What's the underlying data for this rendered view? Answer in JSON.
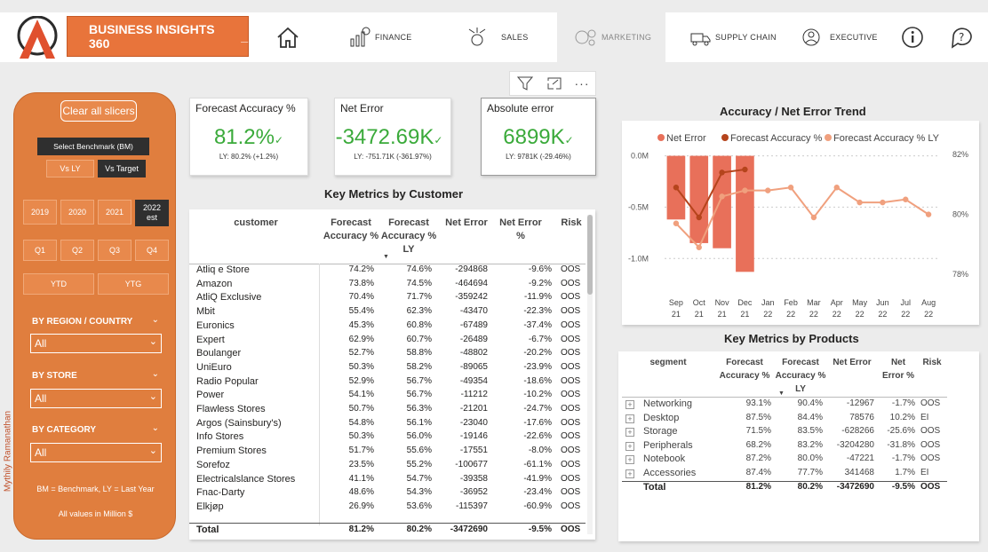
{
  "brand": "BUSINESS INSIGHTS 360",
  "brand_suffix": "_",
  "nav": [
    {
      "label": "FINANCE"
    },
    {
      "label": "SALES"
    },
    {
      "label": "MARKETING"
    },
    {
      "label": "SUPPLY CHAIN"
    },
    {
      "label": "EXECUTIVE"
    }
  ],
  "toolbar": {
    "more": "···"
  },
  "slicer": {
    "clear": "Clear all slicers",
    "benchmark_label": "Select Benchmark (BM)",
    "vs_ly": "Vs LY",
    "vs_target": "Vs Target",
    "years": [
      "2019",
      "2020",
      "2021",
      "2022 est"
    ],
    "quarters": [
      "Q1",
      "Q2",
      "Q3",
      "Q4"
    ],
    "ytd": "YTD",
    "ytg": "YTG",
    "region_label": "BY REGION / COUNTRY",
    "region_value": "All",
    "store_label": "BY STORE",
    "store_value": "All",
    "category_label": "BY CATEGORY",
    "category_value": "All",
    "note1": "BM = Benchmark, LY = Last Year",
    "note2": "All values in Million $",
    "author": "Mythily Ramanathan"
  },
  "kpis": {
    "fa": {
      "title": "Forecast Accuracy %",
      "value": "81.2%",
      "sub": "LY: 80.2% (+1.2%)"
    },
    "ne": {
      "title": "Net Error",
      "value": "-3472.69K",
      "sub": "LY: -751.71K (-361.97%)"
    },
    "ae": {
      "title": "Absolute error",
      "value": "6899K",
      "sub": "LY: 9781K (-29.46%)"
    }
  },
  "colors": {
    "accent": "#e07e3e",
    "good": "#3aaa3a",
    "bar": "#e8705a",
    "line_dark": "#b5441c",
    "line_light": "#f0a07e"
  },
  "customer_table": {
    "title": "Key Metrics by Customer",
    "headers": [
      "customer",
      "Forecast Accuracy %",
      "Forecast Accuracy % LY",
      "Net Error",
      "Net Error %",
      "Risk"
    ],
    "rows": [
      [
        "Atliq e Store",
        "74.2%",
        "74.6%",
        "-294868",
        "-9.6%",
        "OOS"
      ],
      [
        "Amazon",
        "73.8%",
        "74.5%",
        "-464694",
        "-9.2%",
        "OOS"
      ],
      [
        "AtliQ Exclusive",
        "70.4%",
        "71.7%",
        "-359242",
        "-11.9%",
        "OOS"
      ],
      [
        "Mbit",
        "55.4%",
        "62.3%",
        "-43470",
        "-22.3%",
        "OOS"
      ],
      [
        "Euronics",
        "45.3%",
        "60.8%",
        "-67489",
        "-37.4%",
        "OOS"
      ],
      [
        "Expert",
        "62.9%",
        "60.7%",
        "-26489",
        "-6.7%",
        "OOS"
      ],
      [
        "Boulanger",
        "52.7%",
        "58.8%",
        "-48802",
        "-20.2%",
        "OOS"
      ],
      [
        "UniEuro",
        "50.3%",
        "58.2%",
        "-89065",
        "-23.9%",
        "OOS"
      ],
      [
        "Radio Popular",
        "52.9%",
        "56.7%",
        "-49354",
        "-18.6%",
        "OOS"
      ],
      [
        "Power",
        "54.1%",
        "56.7%",
        "-11212",
        "-10.2%",
        "OOS"
      ],
      [
        "Flawless Stores",
        "50.7%",
        "56.3%",
        "-21201",
        "-24.7%",
        "OOS"
      ],
      [
        "Argos (Sainsbury's)",
        "54.8%",
        "56.1%",
        "-23040",
        "-17.6%",
        "OOS"
      ],
      [
        "Info Stores",
        "50.3%",
        "56.0%",
        "-19146",
        "-22.6%",
        "OOS"
      ],
      [
        "Premium Stores",
        "51.7%",
        "55.6%",
        "-17551",
        "-8.0%",
        "OOS"
      ],
      [
        "Sorefoz",
        "23.5%",
        "55.2%",
        "-100677",
        "-61.1%",
        "OOS"
      ],
      [
        "Electricalslance Stores",
        "41.1%",
        "54.7%",
        "-39358",
        "-41.9%",
        "OOS"
      ],
      [
        "Fnac-Darty",
        "48.6%",
        "54.3%",
        "-36952",
        "-23.4%",
        "OOS"
      ],
      [
        "Elkjøp",
        "26.9%",
        "53.6%",
        "-115397",
        "-60.9%",
        "OOS"
      ]
    ],
    "total": [
      "Total",
      "81.2%",
      "80.2%",
      "-3472690",
      "-9.5%",
      "OOS"
    ]
  },
  "product_table": {
    "title": "Key Metrics by Products",
    "headers": [
      "segment",
      "Forecast Accuracy %",
      "Forecast Accuracy % LY",
      "Net Error",
      "Net Error %",
      "Risk"
    ],
    "rows": [
      [
        "Networking",
        "93.1%",
        "90.4%",
        "-12967",
        "-1.7%",
        "OOS"
      ],
      [
        "Desktop",
        "87.5%",
        "84.4%",
        "78576",
        "10.2%",
        "EI"
      ],
      [
        "Storage",
        "71.5%",
        "83.5%",
        "-628266",
        "-25.6%",
        "OOS"
      ],
      [
        "Peripherals",
        "68.2%",
        "83.2%",
        "-3204280",
        "-31.8%",
        "OOS"
      ],
      [
        "Notebook",
        "87.2%",
        "80.0%",
        "-47221",
        "-1.7%",
        "OOS"
      ],
      [
        "Accessories",
        "87.4%",
        "77.7%",
        "341468",
        "1.7%",
        "EI"
      ]
    ],
    "total": [
      "Total",
      "81.2%",
      "80.2%",
      "-3472690",
      "-9.5%",
      "OOS"
    ]
  },
  "chart_data": {
    "type": "bar",
    "title": "Accuracy / Net Error Trend",
    "legend": [
      "Net Error",
      "Forecast Accuracy %",
      "Forecast Accuracy % LY"
    ],
    "legend_position": "top",
    "categories": [
      "Sep 21",
      "Oct 21",
      "Nov 21",
      "Dec 21",
      "Jan 22",
      "Feb 22",
      "Mar 22",
      "Apr 22",
      "May 22",
      "Jun 22",
      "Jul 22",
      "Aug 22"
    ],
    "left_axis": {
      "ticks": [
        "0.0M",
        "-0.5M",
        "-1.0M"
      ],
      "range": [
        -1.3,
        0.1
      ]
    },
    "right_axis": {
      "ticks": [
        "82%",
        "80%",
        "78%"
      ],
      "range": [
        77.5,
        82.3
      ]
    },
    "series": [
      {
        "name": "Net Error",
        "kind": "bar",
        "values": [
          -0.62,
          -0.85,
          -0.9,
          -1.13,
          null,
          null,
          null,
          null,
          null,
          null,
          null,
          null
        ]
      },
      {
        "name": "Forecast Accuracy %",
        "kind": "line",
        "values": [
          80.9,
          79.9,
          81.4,
          81.5,
          null,
          null,
          null,
          null,
          null,
          null,
          null,
          null
        ]
      },
      {
        "name": "Forecast Accuracy % LY",
        "kind": "line",
        "values": [
          79.7,
          78.9,
          80.6,
          80.8,
          80.8,
          80.9,
          79.9,
          80.9,
          80.4,
          80.4,
          80.5,
          80.0
        ]
      }
    ]
  }
}
